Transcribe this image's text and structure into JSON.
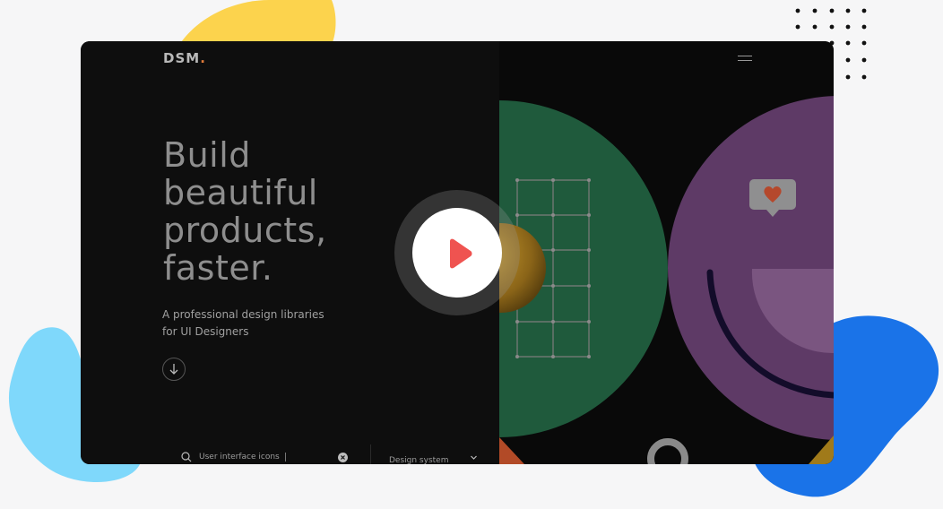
{
  "brand": {
    "name": "DSM",
    "dot": "."
  },
  "hero": {
    "headline_lines": [
      "Build",
      "beautiful",
      "products,",
      "faster."
    ],
    "subtitle_lines": [
      "A professional design libraries",
      "for UI Designers"
    ]
  },
  "search": {
    "value": "User interface icons"
  },
  "category_select": {
    "selected": "Design system"
  },
  "icons": [
    "menu-icon",
    "arrow-down-icon",
    "search-icon",
    "clear-icon",
    "chevron-down-icon",
    "play-icon",
    "heart-icon"
  ],
  "colors": {
    "page_bg": "#f6f6f7",
    "frame_bg": "#0b0b0b",
    "headline": "#8e8e8e",
    "logo_dot": "#e07b3a",
    "play": "#ef5350",
    "green": "#1f5a3c",
    "purple": "#5e3a66",
    "blob_yellow": "#fcd34d",
    "blob_cyan": "#7fd8fb",
    "blob_blue": "#1a73e8"
  }
}
